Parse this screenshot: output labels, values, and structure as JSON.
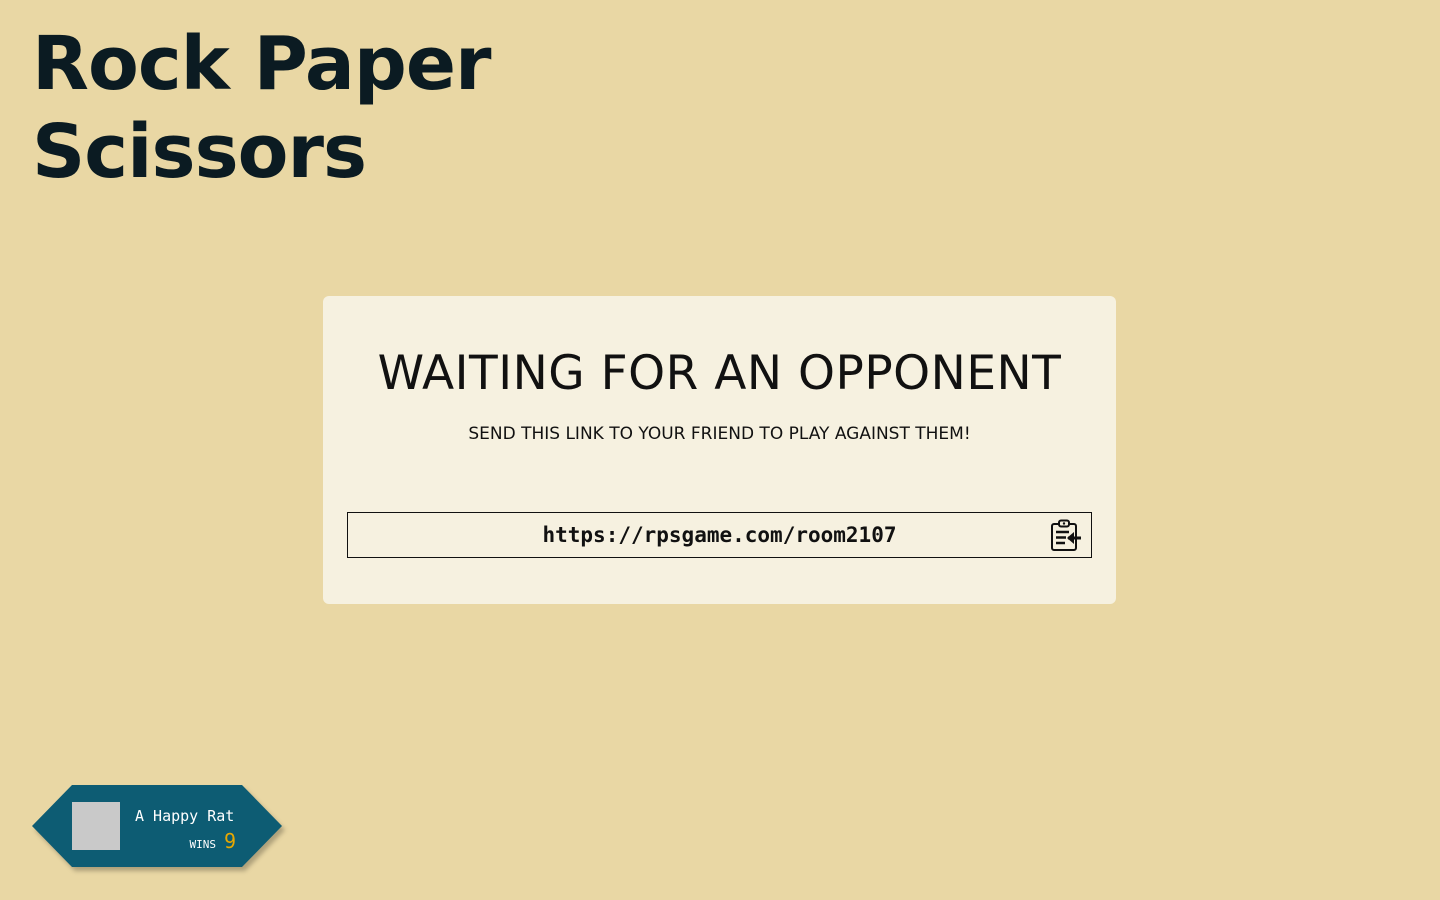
{
  "app": {
    "title_line1": "Rock Paper",
    "title_line2": "Scissors"
  },
  "waiting_card": {
    "heading": "WAITING FOR AN OPPONENT",
    "subheading": "SEND THIS LINK TO YOUR FRIEND TO PLAY AGAINST THEM!",
    "link": "https://rpsgame.com/room2107",
    "copy_icon": "clipboard-copy-icon"
  },
  "player": {
    "name": "A Happy Rat",
    "wins_label": "WINS",
    "wins": "9",
    "avatar_icon": "avatar-placeholder"
  },
  "colors": {
    "background": "#e9d7a4",
    "card": "#f6f1e0",
    "badge": "#0d5c73",
    "wins_accent": "#e8a800",
    "text": "#0b1b22"
  }
}
